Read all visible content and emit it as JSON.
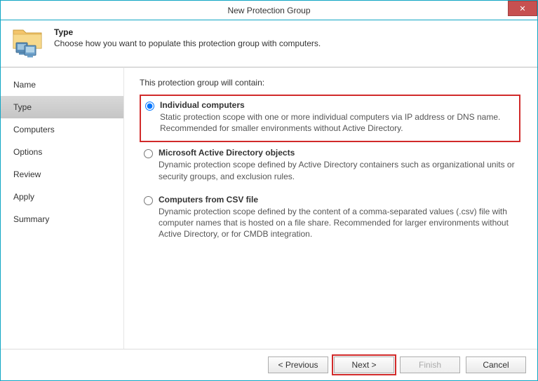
{
  "window": {
    "title": "New Protection Group"
  },
  "header": {
    "title": "Type",
    "description": "Choose how you want to populate this protection group with computers."
  },
  "sidebar": {
    "items": [
      {
        "label": "Name",
        "active": false
      },
      {
        "label": "Type",
        "active": true
      },
      {
        "label": "Computers",
        "active": false
      },
      {
        "label": "Options",
        "active": false
      },
      {
        "label": "Review",
        "active": false
      },
      {
        "label": "Apply",
        "active": false
      },
      {
        "label": "Summary",
        "active": false
      }
    ]
  },
  "content": {
    "heading": "This protection group will contain:",
    "options": [
      {
        "title": "Individual computers",
        "description": "Static protection scope with one or more individual computers via IP address or DNS name. Recommended for smaller environments without Active Directory.",
        "selected": true,
        "highlighted": true
      },
      {
        "title": "Microsoft Active Directory objects",
        "description": "Dynamic protection scope defined by Active Directory containers such as organizational units or security groups, and exclusion rules.",
        "selected": false,
        "highlighted": false
      },
      {
        "title": "Computers from CSV file",
        "description": "Dynamic protection scope defined by the content of a comma-separated values (.csv) file with computer names that is hosted on a file share. Recommended for larger environments without Active Directory, or for CMDB integration.",
        "selected": false,
        "highlighted": false
      }
    ]
  },
  "footer": {
    "previous": "< Previous",
    "next": "Next >",
    "finish": "Finish",
    "cancel": "Cancel"
  }
}
